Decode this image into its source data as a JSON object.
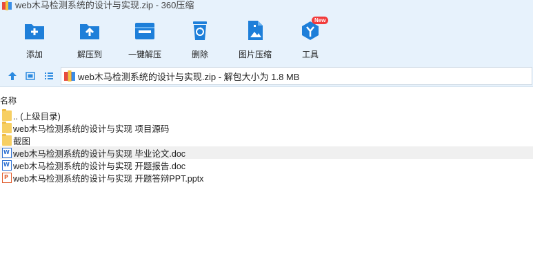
{
  "window": {
    "title": "web木马检测系统的设计与实现.zip - 360压缩"
  },
  "toolbar": {
    "add_label": "添加",
    "extract_to_label": "解压到",
    "one_click_extract_label": "一键解压",
    "delete_label": "删除",
    "image_compress_label": "图片压缩",
    "tools_label": "工具",
    "tools_badge": "New"
  },
  "addressbar": {
    "path_text": "web木马检测系统的设计与实现.zip - 解包大小为 1.8 MB"
  },
  "columns": {
    "name_header": "名称"
  },
  "files": [
    {
      "name": ".. (上级目录)",
      "type": "folder"
    },
    {
      "name": "web木马检测系统的设计与实现 项目源码",
      "type": "folder"
    },
    {
      "name": "截图",
      "type": "folder"
    },
    {
      "name": "web木马检测系统的设计与实现 毕业论文.doc",
      "type": "doc"
    },
    {
      "name": "web木马检测系统的设计与实现 开题报告.doc",
      "type": "doc"
    },
    {
      "name": "web木马检测系统的设计与实现 开题答辩PPT.pptx",
      "type": "ppt"
    }
  ],
  "colors": {
    "accent": "#2b8ae0",
    "toolbar_bg": "#e7f2fc",
    "badge": "#f23b3b"
  }
}
